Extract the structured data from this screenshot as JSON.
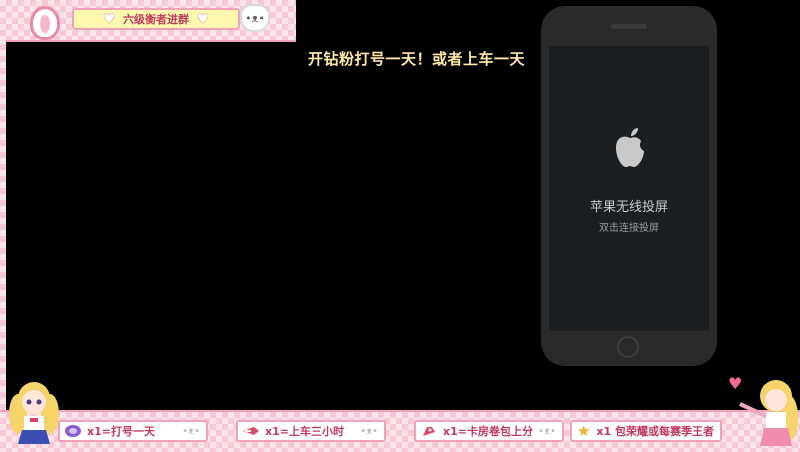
{
  "top": {
    "group_label": "六级衡者进群",
    "heart_glyph": "♥",
    "cat_face": "•ᴥ•"
  },
  "notice": "开钻粉打号一天！或者上车一天",
  "phone": {
    "icon": "apple-icon",
    "title": "苹果无线投屏",
    "hint": "双击连接投屏"
  },
  "gifts": [
    {
      "icon": "purple-gem-icon",
      "text": "x1=打号一天"
    },
    {
      "icon": "rocket-icon",
      "text": "x1=上车三小时"
    },
    {
      "icon": "rocket-icon",
      "text": "x1=卡房卷包上分"
    },
    {
      "icon": "star-wand-icon",
      "text": "x1 包荣耀或每赛季王者"
    }
  ],
  "colors": {
    "frame_pink": "#f6c9d6",
    "notice_yellow": "#ffe9a6",
    "banner_yellow": "#fff9b0"
  }
}
